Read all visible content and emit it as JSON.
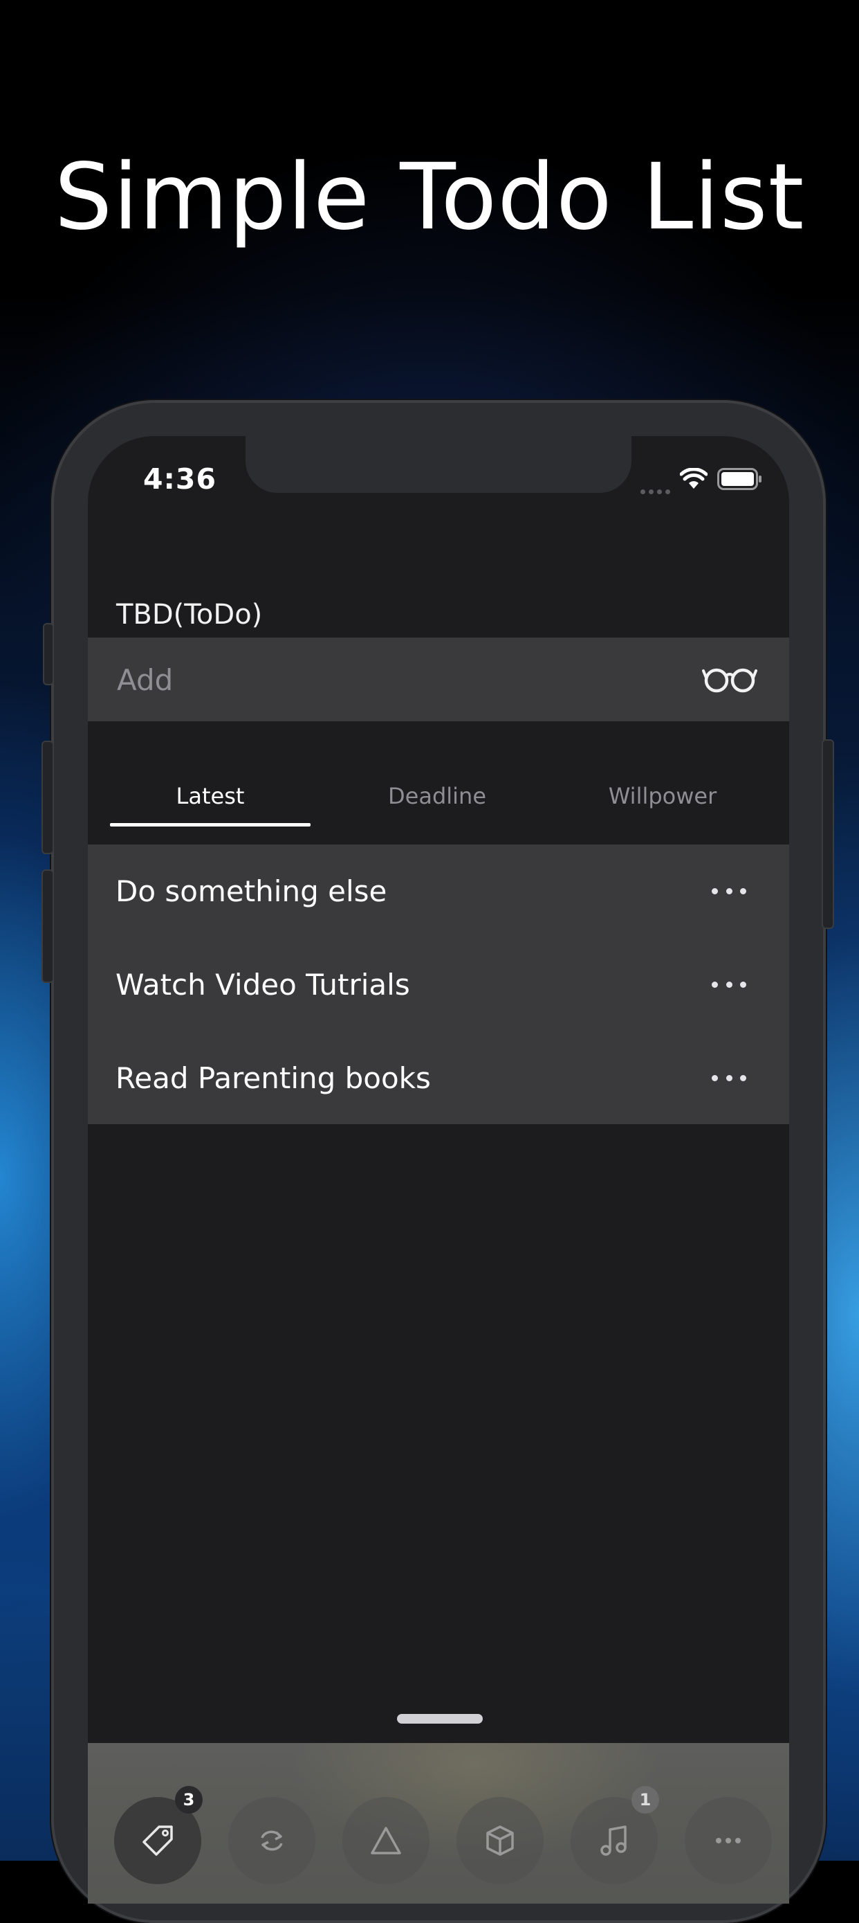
{
  "promo": {
    "headline": "Simple Todo List"
  },
  "status_bar": {
    "time": "4:36"
  },
  "section": {
    "label": "TBD(ToDo)"
  },
  "add_bar": {
    "placeholder": "Add",
    "action_icon": "glasses-icon"
  },
  "tabs": [
    {
      "label": "Latest",
      "active": true
    },
    {
      "label": "Deadline",
      "active": false
    },
    {
      "label": "Willpower",
      "active": false
    }
  ],
  "todos": [
    {
      "text": "Do something else"
    },
    {
      "text": "Watch Video Tutrials"
    },
    {
      "text": "Read Parenting books"
    }
  ],
  "toolbar": {
    "items": [
      {
        "icon": "tag-icon",
        "badge": "3",
        "active": true
      },
      {
        "icon": "repeat-icon",
        "badge": "",
        "active": false
      },
      {
        "icon": "triangle-icon",
        "badge": "",
        "active": false
      },
      {
        "icon": "box-icon",
        "badge": "",
        "active": false
      },
      {
        "icon": "music-note-icon",
        "badge": "1",
        "active": false
      },
      {
        "icon": "more-icon",
        "badge": "",
        "active": false
      }
    ]
  }
}
